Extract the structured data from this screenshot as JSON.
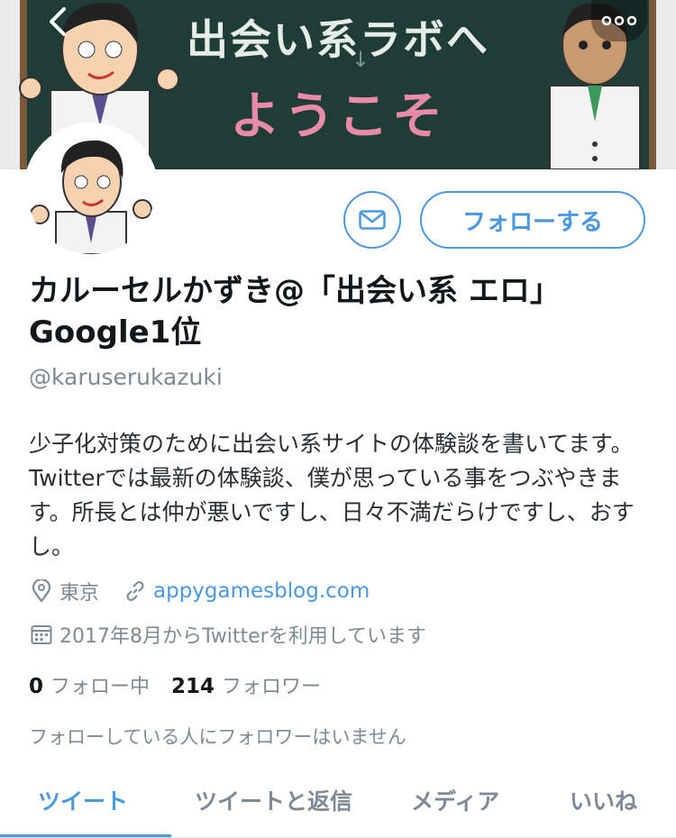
{
  "banner": {
    "line1": "出会い系ラボへ",
    "line2": "ようこそ"
  },
  "profile": {
    "name": "カルーセルかずき@「出会い系 エロ」Google1位",
    "handle": "@karuserukazuki",
    "bio": "少子化対策のために出会い系サイトの体験談を書いてます。Twitterでは最新の体験談、僕が思っている事をつぶやきます。所長とは仲が悪いですし、日々不満だらけですし、おすし。",
    "location": "東京",
    "website": "appygamesblog.com",
    "joined": "2017年8月からTwitterを利用しています"
  },
  "actions": {
    "follow_label": "フォローする"
  },
  "stats": {
    "following_count": "0",
    "following_label": "フォロー中",
    "followers_count": "214",
    "followers_label": "フォロワー"
  },
  "note": "フォローしている人にフォロワーはいません",
  "tabs": [
    {
      "label": "ツイート",
      "active": true
    },
    {
      "label": "ツイートと返信",
      "active": false
    },
    {
      "label": "メディア",
      "active": false
    },
    {
      "label": "いいね",
      "active": false
    }
  ],
  "colors": {
    "accent": "#4a98e0",
    "muted": "#7f8a94",
    "board": "#1f3d36",
    "board_pink": "#e88aa8"
  },
  "icons": {
    "back": "chevron-left-icon",
    "more": "ellipsis-icon",
    "message": "envelope-icon",
    "location": "map-pin-icon",
    "website": "link-icon",
    "joined": "calendar-icon"
  }
}
